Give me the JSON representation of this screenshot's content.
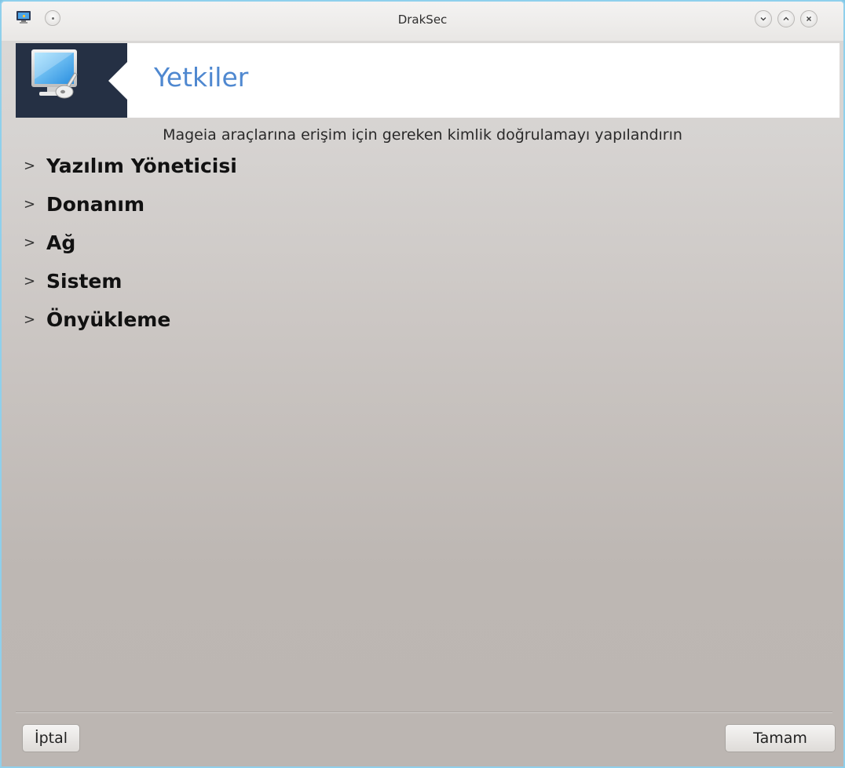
{
  "window": {
    "title": "DrakSec"
  },
  "banner": {
    "title": "Yetkiler"
  },
  "subtitle": "Mageia araçlarına erişim için gereken kimlik doğrulamayı yapılandırın",
  "tree": {
    "expander_glyph": ">",
    "items": [
      {
        "label": "Yazılım Yöneticisi"
      },
      {
        "label": "Donanım"
      },
      {
        "label": "Ağ"
      },
      {
        "label": "Sistem"
      },
      {
        "label": "Önyükleme"
      }
    ]
  },
  "buttons": {
    "cancel": "İptal",
    "ok": "Tamam"
  },
  "icons": {
    "app": "monitor-icon",
    "pin": "pin-icon",
    "minimize": "minimize-icon",
    "maximize": "maximize-icon",
    "close": "close-icon",
    "banner": "monitor-key-icon"
  },
  "colors": {
    "banner_title": "#4f88d0",
    "banner_dark": "#253044",
    "window_border": "#8fd0ec"
  }
}
